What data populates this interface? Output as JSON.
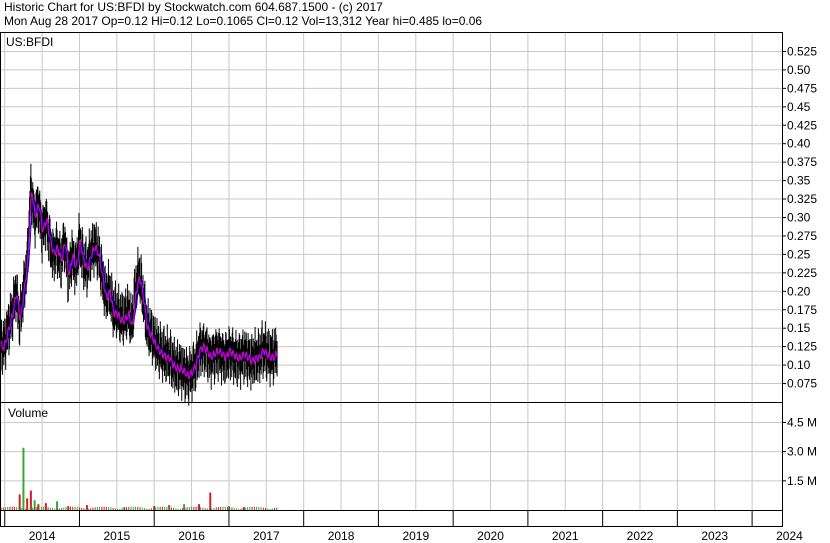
{
  "header": {
    "line1": "Historic Chart for US:BFDI by Stockwatch.com 604.687.1500 - (c) 2017",
    "line2": "Mon Aug 28 2017   Op=0.12  Hi=0.12  Lo=0.1065  Cl=0.12  Vol=13,312  Year hi=0.485  lo=0.06"
  },
  "price_panel": {
    "label": "US:BFDI"
  },
  "volume_panel": {
    "label": "Volume"
  },
  "colors": {
    "price_bar": "#000000",
    "ma_fast": "#cc00cc",
    "ma_slow": "#0000cc",
    "vol_up": "#33aa33",
    "vol_down": "#cc2222",
    "grid": "#c8c8c8"
  },
  "chart_data": [
    {
      "type": "line",
      "title": "US:BFDI",
      "x_tick_labels": [
        "2014",
        "2015",
        "2016",
        "2017",
        "2018",
        "2019",
        "2020",
        "2021",
        "2022",
        "2023",
        "2024"
      ],
      "y_tick_labels": [
        "0.525",
        "0.50",
        "0.475",
        "0.45",
        "0.425",
        "0.40",
        "0.375",
        "0.35",
        "0.325",
        "0.30",
        "0.275",
        "0.25",
        "0.225",
        "0.20",
        "0.175",
        "0.15",
        "0.125",
        "0.10",
        "0.075"
      ],
      "ylim": [
        0.05,
        0.55
      ],
      "xlim": [
        2013.95,
        2024.4
      ],
      "grid": true,
      "series": [
        {
          "role": "price",
          "x": [
            2013.95,
            2014.0,
            2014.05,
            2014.1,
            2014.15,
            2014.2,
            2014.25,
            2014.3,
            2014.35,
            2014.4,
            2014.45,
            2014.5,
            2014.55,
            2014.6,
            2014.65,
            2014.7,
            2014.75,
            2014.8,
            2014.85,
            2014.9,
            2014.95,
            2015.0,
            2015.05,
            2015.1,
            2015.15,
            2015.2,
            2015.25,
            2015.3,
            2015.35,
            2015.4,
            2015.45,
            2015.5,
            2015.55,
            2015.6,
            2015.65,
            2015.7,
            2015.75,
            2015.8,
            2015.85,
            2015.9,
            2015.95,
            2016.0,
            2016.05,
            2016.1,
            2016.15,
            2016.2,
            2016.25,
            2016.3,
            2016.35,
            2016.4,
            2016.45,
            2016.5,
            2016.55,
            2016.6,
            2016.65,
            2016.7,
            2016.75,
            2016.8,
            2016.85,
            2016.9,
            2016.95,
            2017.0,
            2017.05,
            2017.1,
            2017.15,
            2017.2,
            2017.25,
            2017.3,
            2017.35,
            2017.4,
            2017.45,
            2017.5,
            2017.55,
            2017.6,
            2017.65
          ],
          "y": [
            0.12,
            0.13,
            0.15,
            0.17,
            0.2,
            0.16,
            0.2,
            0.24,
            0.34,
            0.3,
            0.32,
            0.28,
            0.3,
            0.27,
            0.25,
            0.26,
            0.24,
            0.27,
            0.22,
            0.25,
            0.23,
            0.27,
            0.24,
            0.23,
            0.25,
            0.26,
            0.25,
            0.22,
            0.19,
            0.2,
            0.17,
            0.17,
            0.16,
            0.16,
            0.17,
            0.15,
            0.2,
            0.22,
            0.19,
            0.15,
            0.14,
            0.13,
            0.12,
            0.115,
            0.11,
            0.11,
            0.1,
            0.095,
            0.095,
            0.09,
            0.085,
            0.09,
            0.1,
            0.12,
            0.125,
            0.12,
            0.11,
            0.115,
            0.12,
            0.115,
            0.11,
            0.12,
            0.115,
            0.11,
            0.11,
            0.115,
            0.11,
            0.105,
            0.11,
            0.11,
            0.12,
            0.115,
            0.11,
            0.11,
            0.12
          ]
        }
      ]
    },
    {
      "type": "bar",
      "title": "Volume",
      "y_tick_labels": [
        "4.5 M",
        "3.0 M",
        "1.5 M"
      ],
      "ylim": [
        0,
        5.5
      ],
      "ylabel": "",
      "x": [
        2014.2,
        2014.25,
        2014.3,
        2014.35,
        2014.4,
        2014.45,
        2014.55,
        2014.7,
        2014.85,
        2015.1,
        2015.6,
        2016.0,
        2016.2,
        2016.4,
        2016.6,
        2016.75,
        2017.0,
        2017.2
      ],
      "values": [
        0.8,
        3.2,
        0.6,
        1.0,
        0.5,
        0.3,
        0.35,
        0.45,
        0.2,
        0.25,
        0.15,
        0.2,
        0.25,
        0.3,
        0.3,
        0.9,
        0.2,
        0.15
      ]
    }
  ]
}
